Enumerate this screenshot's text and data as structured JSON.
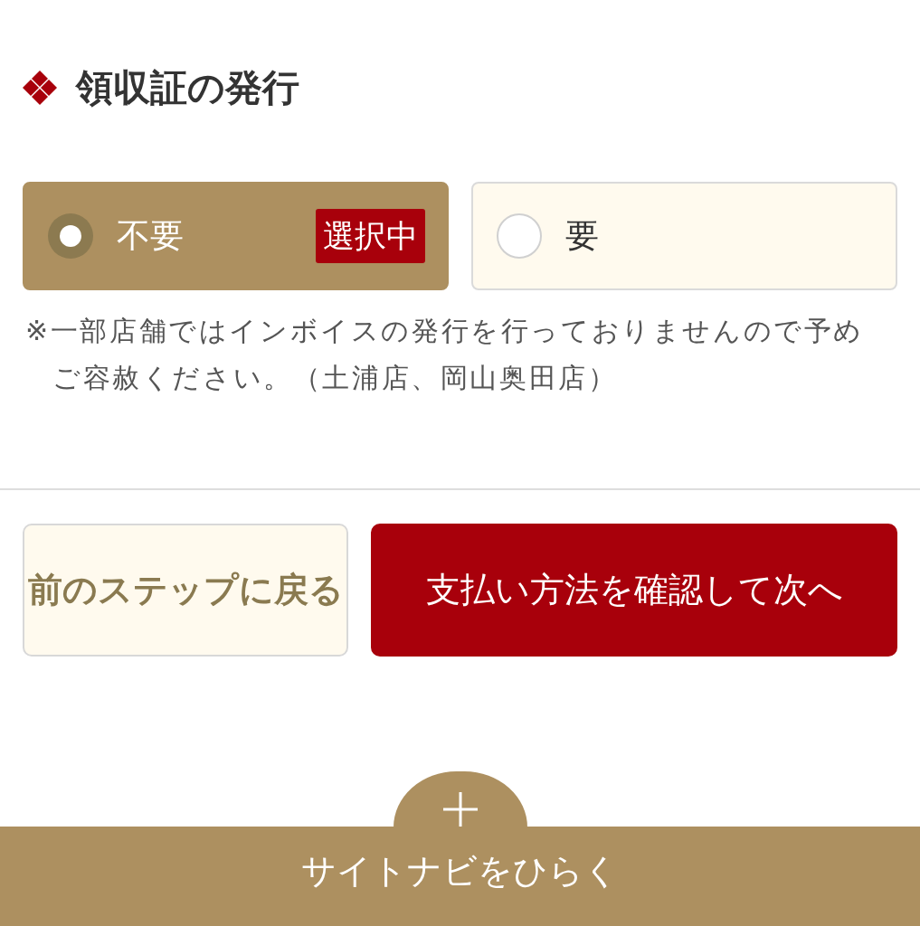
{
  "section": {
    "title": "領収証の発行"
  },
  "options": [
    {
      "label": "不要",
      "selected": true,
      "badge": "選択中"
    },
    {
      "label": "要",
      "selected": false
    }
  ],
  "note": "※一部店舗ではインボイスの発行を行っておりませんので予めご容赦ください。（土浦店、岡山奥田店）",
  "buttons": [
    {
      "kind": "secondary",
      "label": "前のステップに戻る"
    },
    {
      "kind": "primary",
      "label": "支払い方法を確認して次へ"
    }
  ],
  "site_nav": {
    "label": "サイトナビをひらく",
    "expanded": false
  }
}
